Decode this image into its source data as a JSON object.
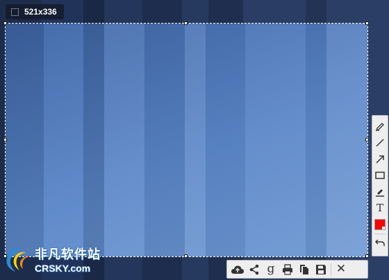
{
  "size_badge": {
    "dimensions": "521x336",
    "icon": "selection-icon"
  },
  "vertical_toolbar": {
    "tools": [
      {
        "name": "pencil-icon"
      },
      {
        "name": "line-icon"
      },
      {
        "name": "arrow-icon"
      },
      {
        "name": "rectangle-icon"
      },
      {
        "name": "marker-icon"
      },
      {
        "name": "text-icon",
        "glyph": "T"
      },
      {
        "name": "color-picker",
        "color": "#ff0000"
      },
      {
        "name": "undo-icon"
      }
    ]
  },
  "horizontal_toolbar": {
    "actions": [
      {
        "name": "upload-cloud-icon"
      },
      {
        "name": "share-icon"
      },
      {
        "name": "google-search-icon",
        "glyph": "g"
      },
      {
        "name": "print-icon"
      },
      {
        "name": "copy-icon"
      },
      {
        "name": "save-icon"
      },
      {
        "name": "close-icon",
        "glyph": "✕"
      }
    ]
  },
  "watermark": {
    "cn": "非凡软件站",
    "en": "CRSKY.com"
  },
  "colors": {
    "accent_red": "#ff0000",
    "selection_blue": "#5a86c8"
  }
}
